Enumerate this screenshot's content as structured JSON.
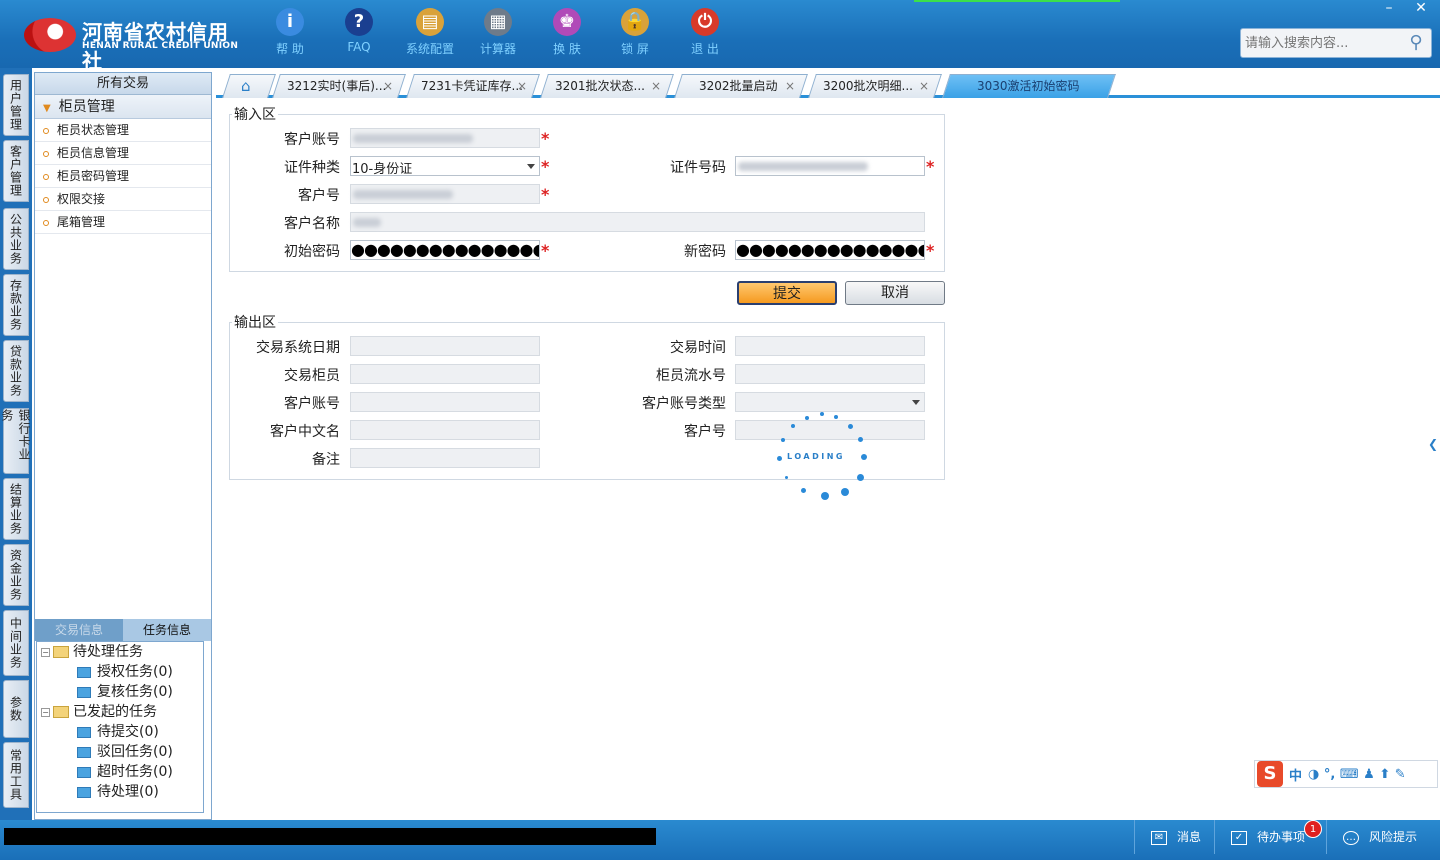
{
  "app": {
    "logo_cn": "河南省农村信用社",
    "logo_en": "HENAN RURAL CREDIT UNION"
  },
  "toolbar": [
    {
      "label": "帮 助",
      "icon": "info-icon",
      "glyph": "i",
      "color": "#3a8be0"
    },
    {
      "label": "FAQ",
      "icon": "question-icon",
      "glyph": "?",
      "color": "#1a3f90"
    },
    {
      "label": "系统配置",
      "icon": "toolbox-icon",
      "glyph": "▤",
      "color": "#d9a23a"
    },
    {
      "label": "计算器",
      "icon": "calculator-icon",
      "glyph": "▦",
      "color": "#6e7b8a"
    },
    {
      "label": "换 肤",
      "icon": "shirt-icon",
      "glyph": "♚",
      "color": "#b04ab8"
    },
    {
      "label": "锁 屏",
      "icon": "lock-icon",
      "glyph": "🔒",
      "color": "#d9a23a"
    },
    {
      "label": "退 出",
      "icon": "power-icon",
      "glyph": "⏻",
      "color": "#d83a2a"
    }
  ],
  "search": {
    "placeholder": "请输入搜索内容..."
  },
  "window": {
    "minimize": "–",
    "close": "✕"
  },
  "left_tabs": [
    "用户管理",
    "客户管理",
    "公共业务",
    "存款业务",
    "贷款业务",
    "银行卡业务",
    "结算业务",
    "资金业务",
    "中间业务",
    "参数",
    "常用工具"
  ],
  "sidebar": {
    "header": "所有交易",
    "group": "柜员管理",
    "items": [
      "柜员状态管理",
      "柜员信息管理",
      "柜员密码管理",
      "权限交接",
      "尾箱管理"
    ],
    "task_tabs": [
      "交易信息",
      "任务信息"
    ],
    "tree": {
      "pending": "待处理任务",
      "auth": "授权任务(0)",
      "review": "复核任务(0)",
      "initiated": "已发起的任务",
      "to_submit": "待提交(0)",
      "rejected": "驳回任务(0)",
      "timeout": "超时任务(0)",
      "to_process": "待处理(0)"
    }
  },
  "tabs": [
    {
      "label": "3212实时(事后)...",
      "close": "×"
    },
    {
      "label": "7231卡凭证库存...",
      "close": "×"
    },
    {
      "label": "3201批次状态...",
      "close": "×"
    },
    {
      "label": "3202批量启动",
      "close": "×"
    },
    {
      "label": "3200批次明细...",
      "close": "×"
    },
    {
      "label": "3030激活初始密码"
    }
  ],
  "input_area": {
    "legend": "输入区",
    "account_label": "客户账号",
    "id_type_label": "证件种类",
    "id_type_value": "10-身份证",
    "id_no_label": "证件号码",
    "cust_no_label": "客户号",
    "cust_name_label": "客户名称",
    "init_pwd_label": "初始密码",
    "init_pwd_value": "●●●●●●●●●●●●●●●●",
    "new_pwd_label": "新密码",
    "new_pwd_value": "●●●●●●●●●●●●●●●●",
    "required_mark": "*"
  },
  "buttons": {
    "submit": "提交",
    "cancel": "取消"
  },
  "output_area": {
    "legend": "输出区",
    "trans_date": "交易系统日期",
    "trans_time": "交易时间",
    "teller": "交易柜员",
    "serial": "柜员流水号",
    "account": "客户账号",
    "account_type": "客户账号类型",
    "cust_cn_name": "客户中文名",
    "cust_no": "客户号",
    "remark": "备注"
  },
  "loading_text": "LOADING",
  "ime": {
    "logo": "S",
    "mode": "中",
    "icons": "◑ °, ⌨ ♟ ⬆ ✎"
  },
  "statusbar": {
    "message": "消息",
    "todo": "待办事项",
    "todo_count": "1",
    "risk": "风险提示"
  }
}
